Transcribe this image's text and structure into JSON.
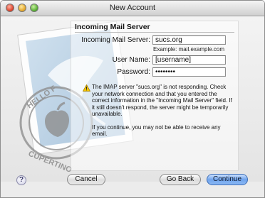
{
  "window": {
    "title": "New Account"
  },
  "section": {
    "heading": "Incoming Mail Server"
  },
  "form": {
    "server_label": "Incoming Mail Server:",
    "server_value": "sucs.org",
    "server_example": "Example: mail.example.com",
    "username_label": "User Name:",
    "username_value": "[username]",
    "password_label": "Password:",
    "password_value": "••••••••"
  },
  "warning": {
    "icon": "warning-triangle-icon",
    "message": "The IMAP server \"sucs.org\" is not responding. Check your network connection and that you entered the correct information in the \"Incoming Mail Server\" field. If it still doesn't respond, the server might be temporarily unavailable.",
    "followup": "If you continue, you may not be able to receive any email."
  },
  "stamp": {
    "text_top": "HELLO F",
    "text_bottom": "CUPERTINO"
  },
  "buttons": {
    "help": "?",
    "cancel": "Cancel",
    "go_back": "Go Back",
    "continue": "Continue"
  },
  "colors": {
    "default_button": "#6fa4ec",
    "window_bg": "#ececec"
  }
}
